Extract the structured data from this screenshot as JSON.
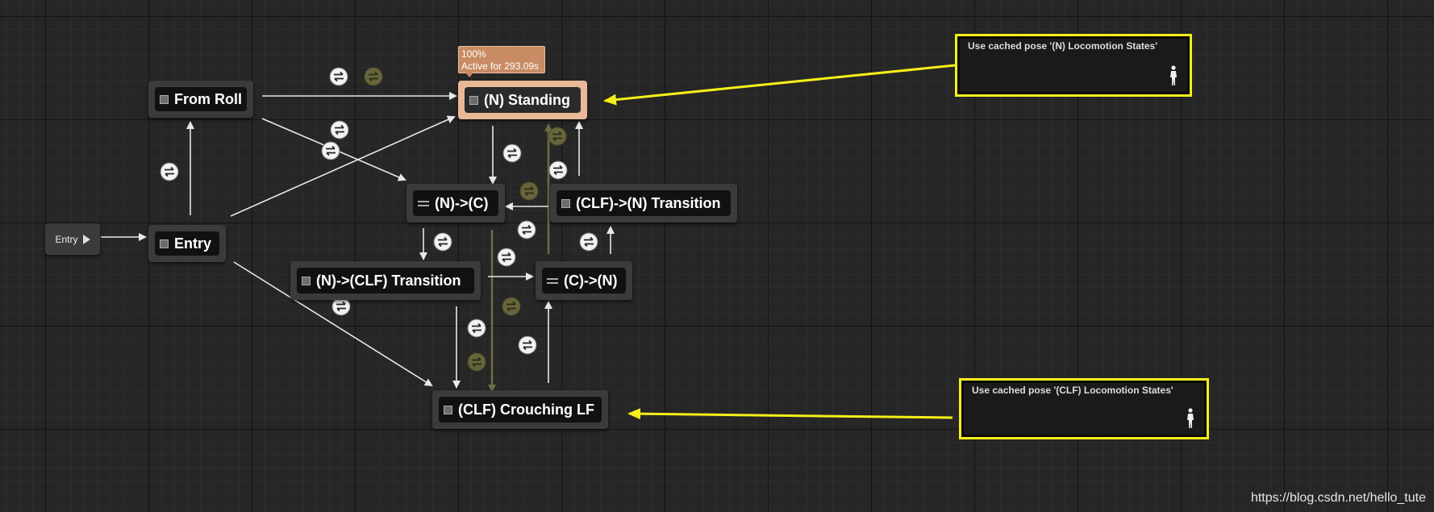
{
  "entry_pin": {
    "label": "Entry"
  },
  "nodes": {
    "from_roll": "From Roll",
    "entry": "Entry",
    "standing": "(N) Standing",
    "n_to_c": "(N)->(C)",
    "clf_to_n": "(CLF)->(N) Transition",
    "n_to_clf": "(N)->(CLF) Transition",
    "c_to_n": "(C)->(N)",
    "crouching": "(CLF) Crouching LF"
  },
  "active_tooltip": {
    "percent": "100%",
    "active_for": "Active for 293.09s"
  },
  "comments": {
    "top": "Use cached pose '(N) Locomotion States'",
    "bottom": "Use cached pose '(CLF) Locomotion States'"
  },
  "colors": {
    "highlight": "#f5ef1a",
    "active_node": "#e9b896"
  },
  "watermark": "https://blog.csdn.net/hello_tute"
}
